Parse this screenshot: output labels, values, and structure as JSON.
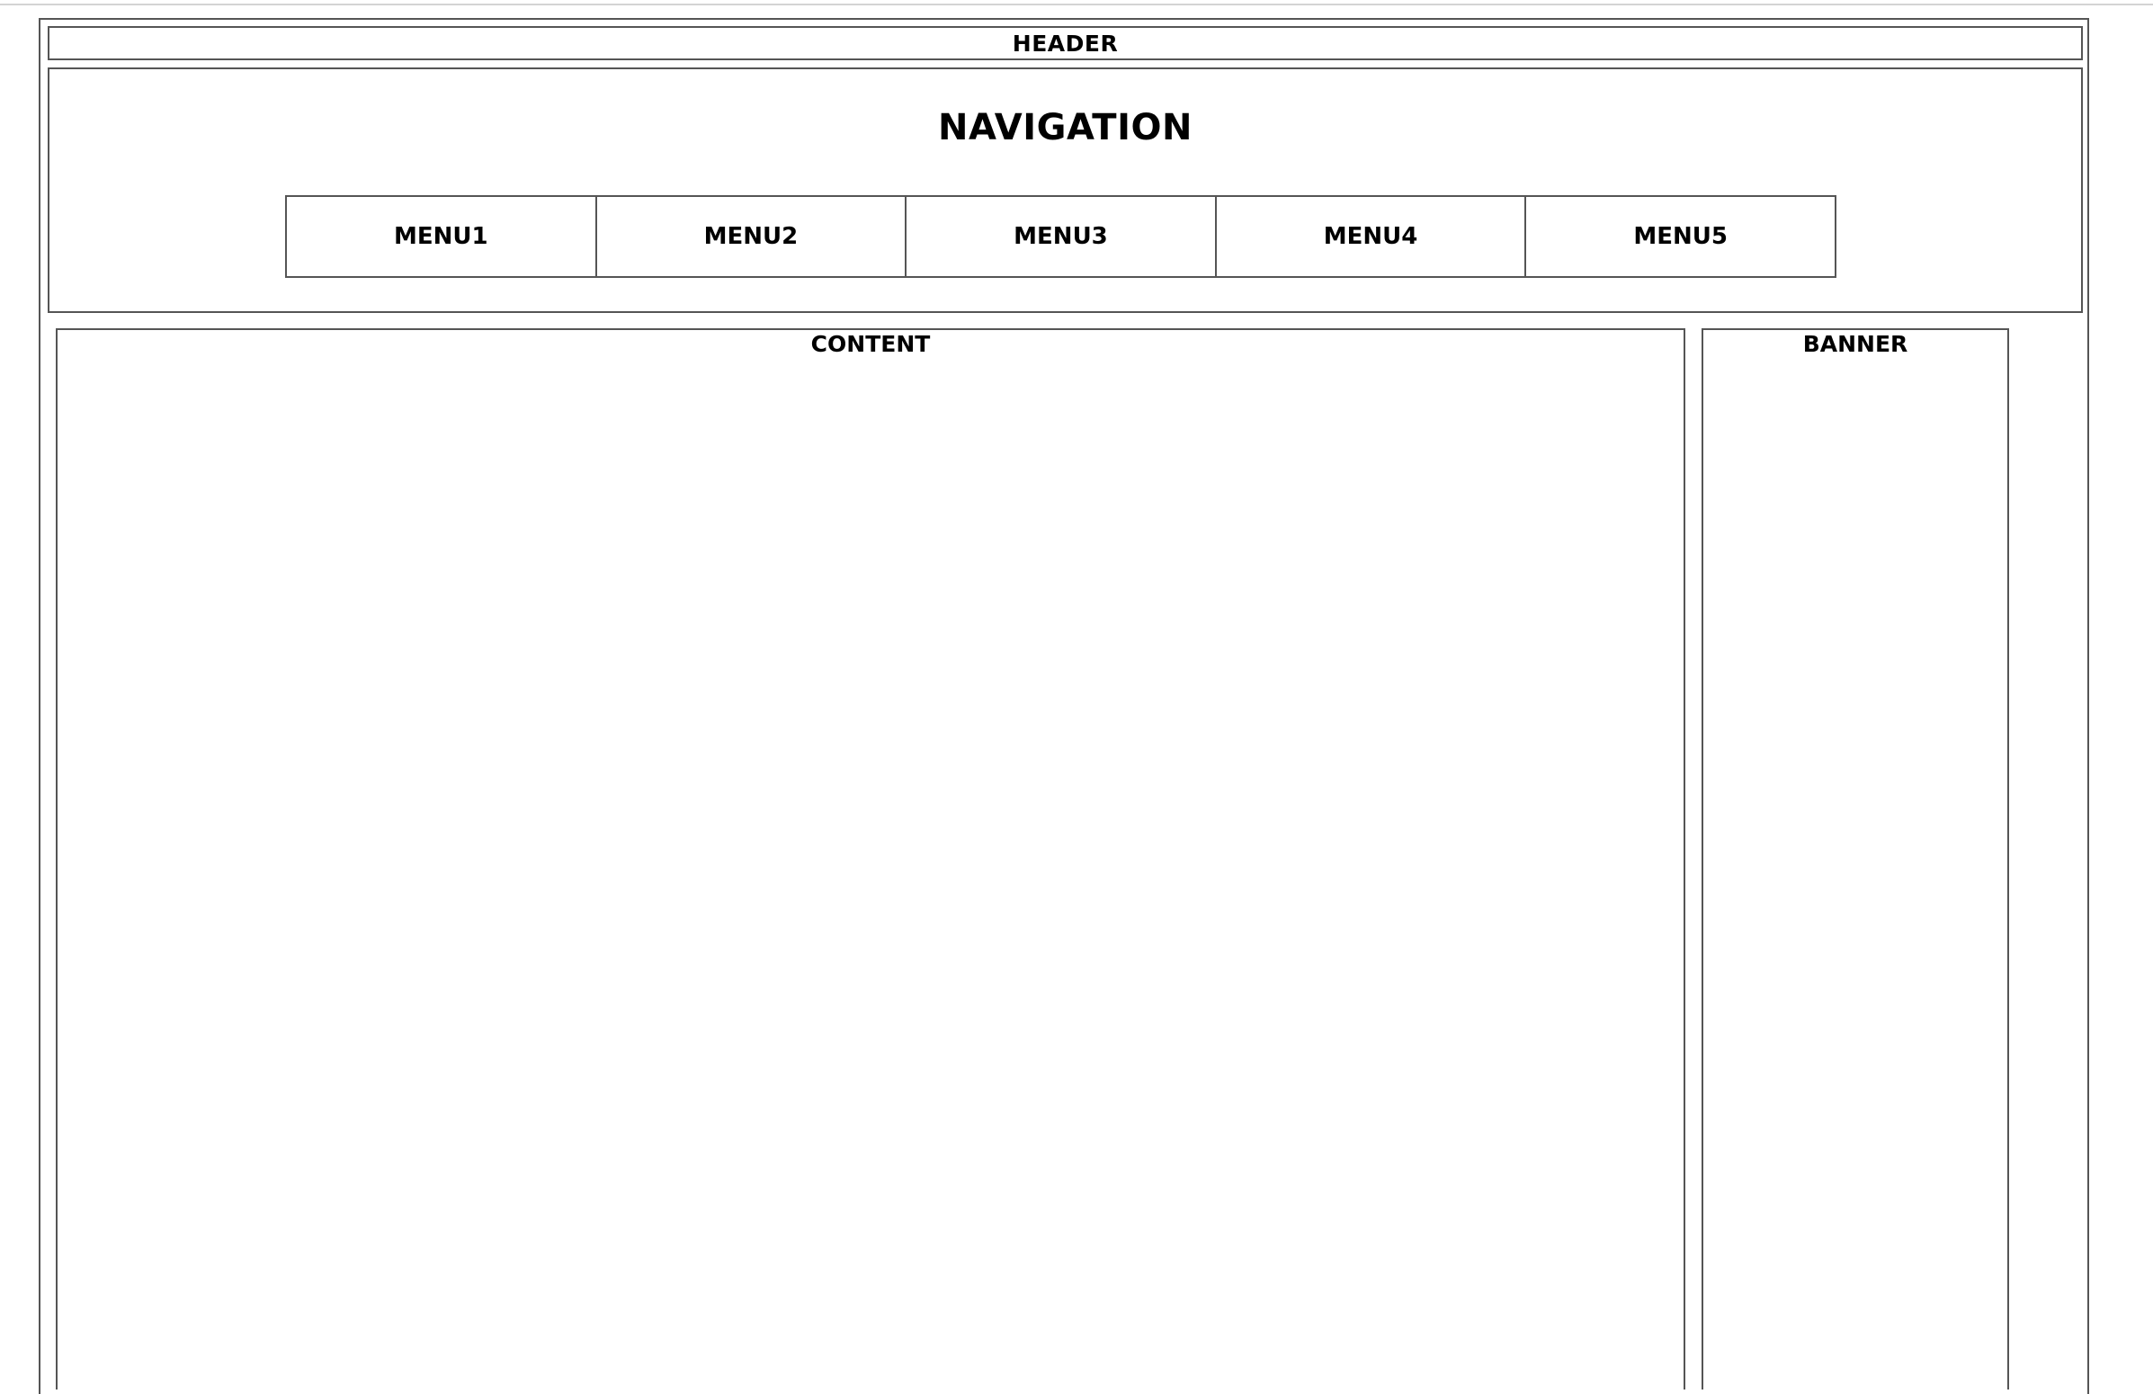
{
  "header": {
    "title": "HEADER"
  },
  "navigation": {
    "title": "NAVIGATION",
    "menu_items": [
      {
        "label": "MENU1"
      },
      {
        "label": "MENU2"
      },
      {
        "label": "MENU3"
      },
      {
        "label": "MENU4"
      },
      {
        "label": "MENU5"
      }
    ]
  },
  "content": {
    "title": "CONTENT"
  },
  "banner": {
    "title": "BANNER"
  },
  "colors": {
    "border": "#555555",
    "background": "#ffffff",
    "text": "#000000"
  }
}
